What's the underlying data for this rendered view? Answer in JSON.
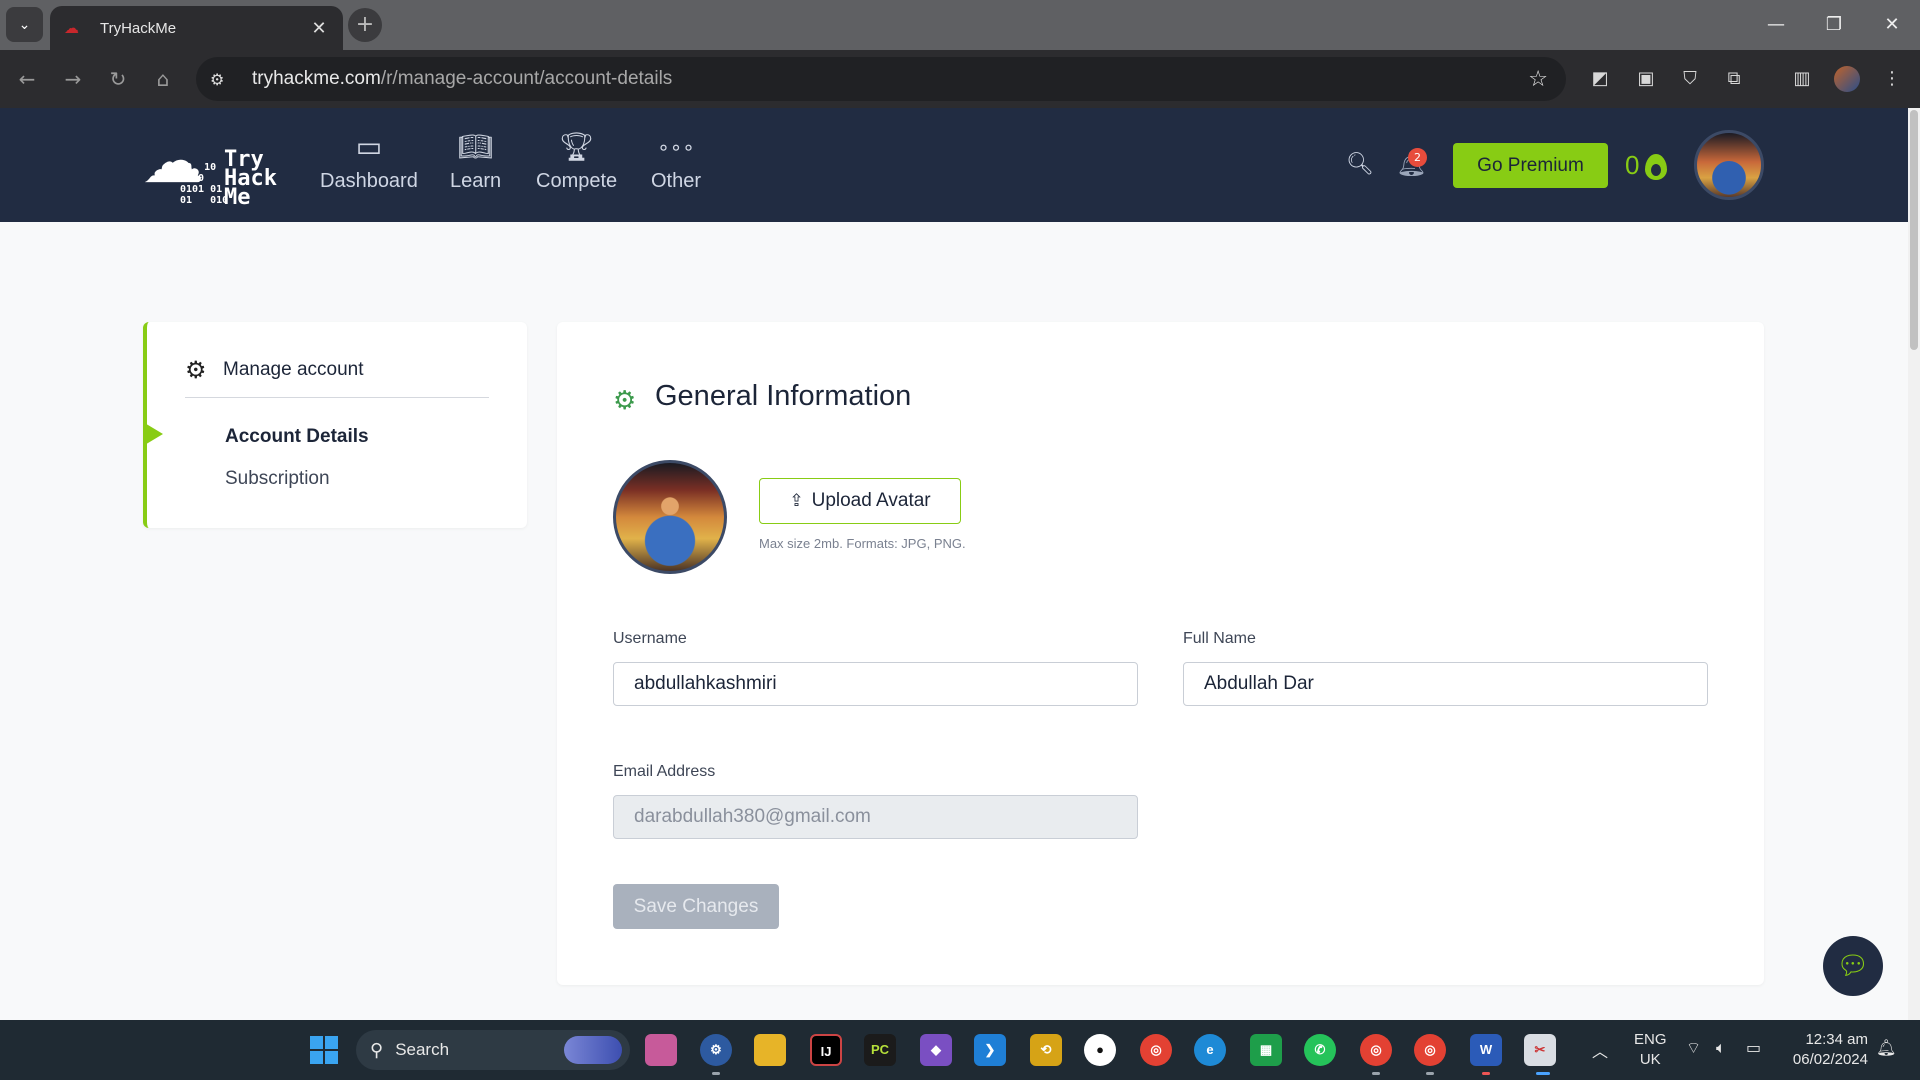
{
  "browser": {
    "tab_title": "TryHackMe",
    "tab_close": "✕",
    "new_tab": "+",
    "url_host": "tryhackme.com",
    "url_path": "/r/manage-account/account-details",
    "window_minimize": "—",
    "window_restore": "❐",
    "window_close": "✕"
  },
  "header": {
    "logo_binary": "10  10\n1110\n0101 01\n01   010",
    "logo_words": "Try\nHack\nMe",
    "nav": [
      {
        "label": "Dashboard",
        "icon": "dashboard-icon"
      },
      {
        "label": "Learn",
        "icon": "book-icon"
      },
      {
        "label": "Compete",
        "icon": "trophy-icon"
      },
      {
        "label": "Other",
        "icon": "more-icon"
      }
    ],
    "notification_count": "2",
    "premium_label": "Go Premium",
    "streak_count": "0"
  },
  "sidebar": {
    "heading": "Manage account",
    "items": [
      {
        "label": "Account Details",
        "active": true
      },
      {
        "label": "Subscription",
        "active": false
      }
    ]
  },
  "main": {
    "title": "General Information",
    "upload_label": "Upload Avatar",
    "upload_hint": "Max size 2mb. Formats: JPG, PNG.",
    "username_label": "Username",
    "username_value": "abdullahkashmiri",
    "fullname_label": "Full Name",
    "fullname_value": "Abdullah Dar",
    "email_label": "Email Address",
    "email_value": "darabdullah380@gmail.com",
    "save_label": "Save Changes"
  },
  "taskbar": {
    "search_label": "Search",
    "lang_top": "ENG",
    "lang_bottom": "UK",
    "time": "12:34 am",
    "date": "06/02/2024"
  },
  "colors": {
    "brand_green": "#88cc14",
    "header_bg": "#212c42"
  }
}
